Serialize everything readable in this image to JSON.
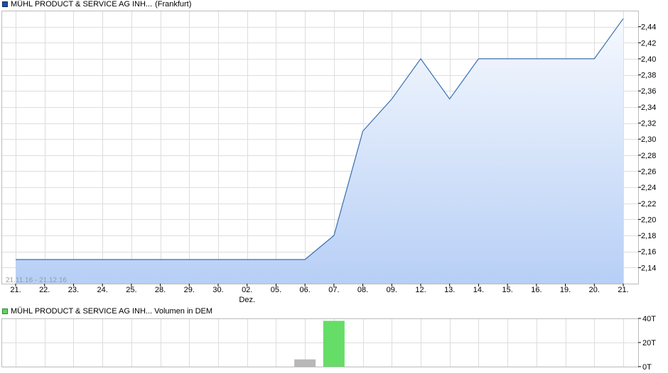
{
  "legend": {
    "price_name": "MÜHL PRODUCT & SERVICE AG INH...",
    "price_exchange": "(Frankfurt)",
    "volume_label": "MÜHL PRODUCT & SERVICE AG INH... Volumen in DEM"
  },
  "colors": {
    "price_line": "#3a6fb0",
    "price_swatch": "#1f4fa0",
    "volume_swatch": "#5fd35f",
    "volume_up": "#66dd66",
    "volume_neutral": "#b8b8b8"
  },
  "chart_data": [
    {
      "type": "area",
      "range_label": "21.11.16 - 21.12.16",
      "categories": [
        "21.",
        "22.",
        "23.",
        "24.",
        "25.",
        "28.",
        "29.",
        "30.",
        "02.",
        "05.",
        "06.",
        "07.",
        "08.",
        "09.",
        "12.",
        "13.",
        "14.",
        "15.",
        "16.",
        "19.",
        "20.",
        "21."
      ],
      "month_label": {
        "index": 8,
        "text": "Dez."
      },
      "values": [
        2.15,
        2.15,
        2.15,
        2.15,
        2.15,
        2.15,
        2.15,
        2.15,
        2.15,
        2.15,
        2.15,
        2.18,
        2.31,
        2.35,
        2.4,
        2.35,
        2.4,
        2.4,
        2.4,
        2.4,
        2.4,
        2.45
      ],
      "ylim": [
        2.12,
        2.46
      ],
      "yticks": [
        "2,14",
        "2,16",
        "2,18",
        "2,20",
        "2,22",
        "2,24",
        "2,26",
        "2,28",
        "2,30",
        "2,32",
        "2,34",
        "2,36",
        "2,38",
        "2,40",
        "2,42",
        "2,44"
      ],
      "ytick_values": [
        2.14,
        2.16,
        2.18,
        2.2,
        2.22,
        2.24,
        2.26,
        2.28,
        2.3,
        2.32,
        2.34,
        2.36,
        2.38,
        2.4,
        2.42,
        2.44
      ],
      "grid": true
    },
    {
      "type": "bar",
      "values": [
        0,
        0,
        0,
        0,
        0,
        0,
        0,
        0,
        0,
        0,
        6000,
        38000,
        0,
        0,
        0,
        0,
        0,
        0,
        0,
        0,
        0,
        0
      ],
      "bar_color_keys": [
        "",
        "",
        "",
        "",
        "",
        "",
        "",
        "",
        "",
        "",
        "volume_neutral",
        "volume_up",
        "",
        "",
        "",
        "",
        "",
        "",
        "",
        "",
        "",
        ""
      ],
      "ylim": [
        0,
        40000
      ],
      "yticks": [
        "0T",
        "20T",
        "40T"
      ],
      "ytick_values": [
        0,
        20000,
        40000
      ],
      "grid": true
    }
  ]
}
